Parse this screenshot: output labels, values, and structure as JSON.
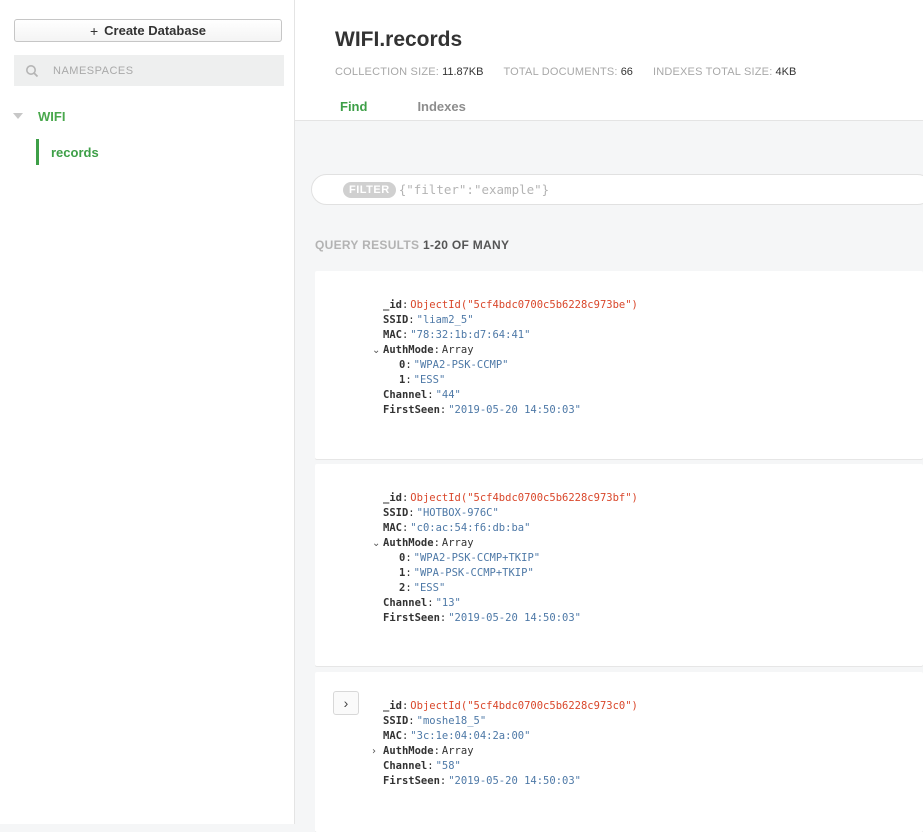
{
  "sidebar": {
    "create_db_label": "Create Database",
    "search_placeholder": "NAMESPACES",
    "database": "WIFI",
    "collection": "records"
  },
  "header": {
    "title": "WIFI.records",
    "stats": {
      "collection_size_label": "COLLECTION SIZE:",
      "collection_size_value": "11.87KB",
      "total_documents_label": "TOTAL DOCUMENTS:",
      "total_documents_value": "66",
      "indexes_size_label": "INDEXES TOTAL SIZE:",
      "indexes_size_value": "4KB"
    },
    "tabs": [
      "Find",
      "Indexes"
    ]
  },
  "filter": {
    "pill": "FILTER",
    "placeholder": "{\"filter\":\"example\"}"
  },
  "results": {
    "label": "QUERY RESULTS",
    "range": "1-20 OF MANY"
  },
  "documents": [
    {
      "id": "ObjectId(\"5cf4bdc0700c5b6228c973be\")",
      "ssid": "\"liam2_5\"",
      "mac": "\"78:32:1b:d7:64:41\"",
      "authmode_type": "Array",
      "authmode": [
        "\"WPA2-PSK-CCMP\"",
        "\"ESS\""
      ],
      "channel": "\"44\"",
      "firstseen": "\"2019-05-20 14:50:03\""
    },
    {
      "id": "ObjectId(\"5cf4bdc0700c5b6228c973bf\")",
      "ssid": "\"HOTBOX-976C\"",
      "mac": "\"c0:ac:54:f6:db:ba\"",
      "authmode_type": "Array",
      "authmode": [
        "\"WPA2-PSK-CCMP+TKIP\"",
        "\"WPA-PSK-CCMP+TKIP\"",
        "\"ESS\""
      ],
      "channel": "\"13\"",
      "firstseen": "\"2019-05-20 14:50:03\""
    },
    {
      "id": "ObjectId(\"5cf4bdc0700c5b6228c973c0\")",
      "ssid": "\"moshe18_5\"",
      "mac": "\"3c:1e:04:04:2a:00\"",
      "authmode_type": "Array",
      "channel": "\"58\"",
      "firstseen": "\"2019-05-20 14:50:03\""
    }
  ],
  "keys": {
    "id": "_id",
    "ssid": "SSID",
    "mac": "MAC",
    "authmode": "AuthMode",
    "channel": "Channel",
    "firstseen": "FirstSeen",
    "i0": "0",
    "i1": "1",
    "i2": "2"
  },
  "colors": {
    "accent_green": "#3d9f47",
    "object_id_red": "#d9472b",
    "string_blue": "#4e79a7"
  }
}
